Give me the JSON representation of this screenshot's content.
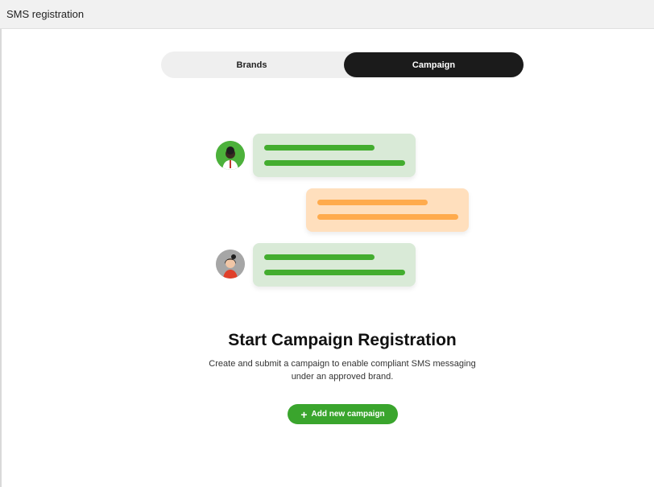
{
  "window": {
    "title": "SMS registration"
  },
  "tabs": {
    "brands_label": "Brands",
    "campaign_label": "Campaign",
    "active": "Campaign"
  },
  "illustration": {
    "icons": [
      "person-avatar-icon",
      "person-avatar-icon"
    ],
    "colors": {
      "green_bubble": "#d9ead7",
      "green_line": "#43ad2f",
      "orange_bubble": "#ffdfbd",
      "orange_line": "#ffab4d"
    }
  },
  "empty_state": {
    "title": "Start Campaign Registration",
    "description": "Create and submit a campaign to enable compliant SMS messaging under an approved brand.",
    "button_label": "Add new campaign",
    "button_icon": "plus-icon"
  },
  "colors": {
    "accent": "#3aa52d",
    "active_tab": "#1b1b1b"
  }
}
